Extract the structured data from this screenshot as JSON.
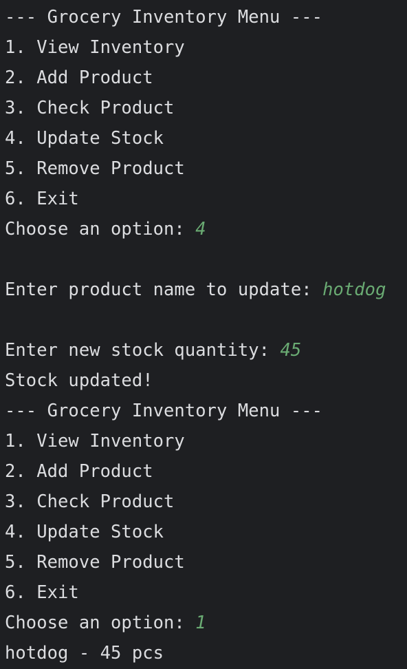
{
  "colors": {
    "background": "#1e1f22",
    "output_text": "#dcdde0",
    "user_input": "#6aab73"
  },
  "lines": [
    {
      "text": "--- Grocery Inventory Menu ---"
    },
    {
      "text": "1. View Inventory"
    },
    {
      "text": "2. Add Product"
    },
    {
      "text": "3. Check Product"
    },
    {
      "text": "4. Update Stock"
    },
    {
      "text": "5. Remove Product"
    },
    {
      "text": "6. Exit"
    },
    {
      "prompt": "Choose an option: ",
      "input": "4"
    },
    {
      "text": ""
    },
    {
      "prompt": "Enter product name to update: ",
      "input": "hotdog"
    },
    {
      "text": ""
    },
    {
      "prompt": "Enter new stock quantity: ",
      "input": "45"
    },
    {
      "text": "Stock updated!"
    },
    {
      "text": "--- Grocery Inventory Menu ---"
    },
    {
      "text": "1. View Inventory"
    },
    {
      "text": "2. Add Product"
    },
    {
      "text": "3. Check Product"
    },
    {
      "text": "4. Update Stock"
    },
    {
      "text": "5. Remove Product"
    },
    {
      "text": "6. Exit"
    },
    {
      "prompt": "Choose an option: ",
      "input": "1"
    },
    {
      "text": "hotdog - 45 pcs"
    }
  ]
}
